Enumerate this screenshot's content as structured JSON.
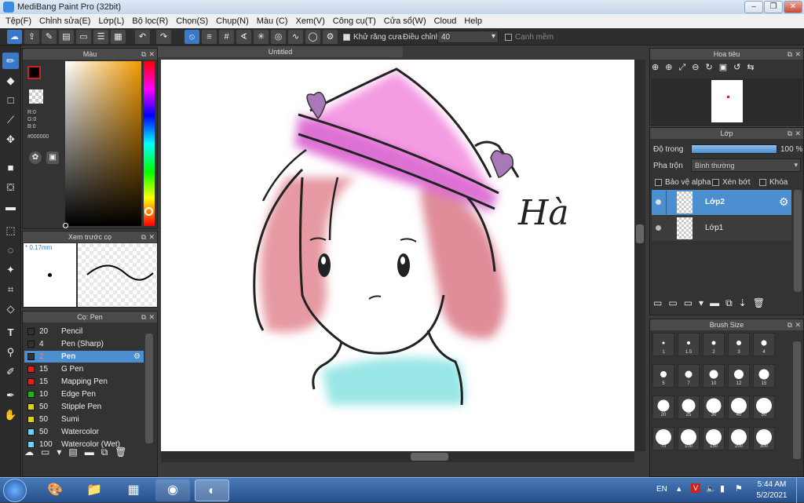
{
  "window": {
    "title": "MediBang Paint Pro (32bit)",
    "min_label": "–",
    "max_label": "❐",
    "close_label": "✕"
  },
  "menu": [
    "Tệp(F)",
    "Chỉnh sửa(E)",
    "Lớp(L)",
    "Bộ lọc(R)",
    "Chọn(S)",
    "Chụp(N)",
    "Màu (C)",
    "Xem(V)",
    "Công cụ(T)",
    "Cửa sổ(W)",
    "Cloud",
    "Help"
  ],
  "toolbar": {
    "antialias_label": "Khử răng cưa",
    "adjust_label": "Điều chỉnh",
    "adjust_value": "40",
    "soft_edge_label": "Cạnh mềm"
  },
  "color_panel": {
    "title": "Màu",
    "r": "R:0",
    "g": "G:0",
    "b": "B:0",
    "hex": "#000000",
    "foreground": "#000000"
  },
  "brush_preview": {
    "title": "Xem trước cọ",
    "size": "* 0.17mm"
  },
  "brush_panel": {
    "title": "Cọ: Pen",
    "items": [
      {
        "size": "20",
        "name": "Pencil",
        "color": "#333333"
      },
      {
        "size": "4",
        "name": "Pen (Sharp)",
        "color": "#333333"
      },
      {
        "size": "2",
        "name": "Pen",
        "color": "#333333",
        "selected": true
      },
      {
        "size": "15",
        "name": "G Pen",
        "color": "#e02020"
      },
      {
        "size": "15",
        "name": "Mapping Pen",
        "color": "#e02020"
      },
      {
        "size": "10",
        "name": "Edge Pen",
        "color": "#20b020"
      },
      {
        "size": "50",
        "name": "Stipple Pen",
        "color": "#e0d020"
      },
      {
        "size": "50",
        "name": "Sumi",
        "color": "#e0d020"
      },
      {
        "size": "50",
        "name": "Watercolor",
        "color": "#70d0f0"
      },
      {
        "size": "100",
        "name": "Watercolor (Wet)",
        "color": "#70d0f0"
      }
    ]
  },
  "canvas": {
    "tab_title": "Untitled",
    "signature": "Hà"
  },
  "navigator": {
    "title": "Hoa tiêu"
  },
  "layer_panel": {
    "title": "Lớp",
    "opacity_label": "Độ trong",
    "opacity_value": "100 %",
    "opacity_fraction": 1.0,
    "blend_label": "Pha trộn",
    "blend_value": "Bình thường",
    "protect_alpha": "Bảo vệ alpha",
    "clipping": "Xén bớt",
    "lock": "Khóa",
    "layers": [
      {
        "name": "Lớp2",
        "selected": true
      },
      {
        "name": "Lớp1",
        "selected": false
      }
    ]
  },
  "brush_size_panel": {
    "title": "Brush Size",
    "sizes": [
      "1",
      "1.5",
      "2",
      "3",
      "4",
      "5",
      "7",
      "10",
      "12",
      "15",
      "20",
      "25",
      "30",
      "40",
      "50",
      "70",
      "100",
      "150",
      "200",
      "300"
    ]
  },
  "taskbar": {
    "lang": "EN",
    "time": "5:44 AM",
    "date": "5/2/2021"
  },
  "colors": {
    "accent": "#4b8fd0",
    "panel_bg": "#333333",
    "titlebar": "#c6d6ea"
  }
}
